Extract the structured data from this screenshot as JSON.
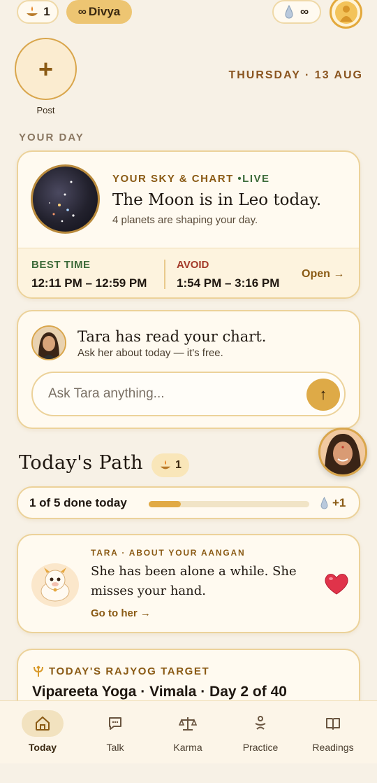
{
  "topbar": {
    "streak_count": "1",
    "plan_label": "Divya",
    "plan_symbol": "∞",
    "gems_value": "∞"
  },
  "post": {
    "label": "Post",
    "icon": "+"
  },
  "date": "THURSDAY · 13 AUG",
  "section_your_day": "YOUR DAY",
  "sky_card": {
    "kicker": "YOUR SKY & CHART",
    "live": "•LIVE",
    "title": "The Moon is in Leo today.",
    "subtitle": "4 planets are shaping your day.",
    "best_time_label": "BEST TIME",
    "best_time_value": "12:11 PM – 12:59 PM",
    "avoid_label": "AVOID",
    "avoid_value": "1:54 PM – 3:16 PM",
    "open_label": "Open →"
  },
  "tara_card": {
    "title": "Tara has read your chart.",
    "subtitle": "Ask her about today — it's free.",
    "input_placeholder": "Ask Tara anything...",
    "send_icon": "↑"
  },
  "path": {
    "title": "Today's Path",
    "badge_count": "1",
    "progress_label": "1 of 5 done today",
    "progress_fraction": 0.2,
    "reward": "+1"
  },
  "aangan_card": {
    "kicker": "TARA · ABOUT YOUR AANGAN",
    "text": "She has been alone a while. She misses your hand.",
    "link": "Go to her →"
  },
  "rajyog_card": {
    "kicker": "TODAY'S RAJYOG TARGET",
    "title": "Vipareeta Yoga · Vimala · Day 2 of 40"
  },
  "nav": [
    {
      "label": "Today",
      "icon": "home-icon",
      "active": true
    },
    {
      "label": "Talk",
      "icon": "chat-icon",
      "active": false
    },
    {
      "label": "Karma",
      "icon": "scales-icon",
      "active": false
    },
    {
      "label": "Practice",
      "icon": "meditation-icon",
      "active": false
    },
    {
      "label": "Readings",
      "icon": "book-icon",
      "active": false
    }
  ],
  "colors": {
    "background": "#f7f1e6",
    "accent_gold": "#deaa47",
    "brown_text": "#8a5a14",
    "green_label": "#3d6b3a",
    "red_label": "#a43b2a"
  }
}
